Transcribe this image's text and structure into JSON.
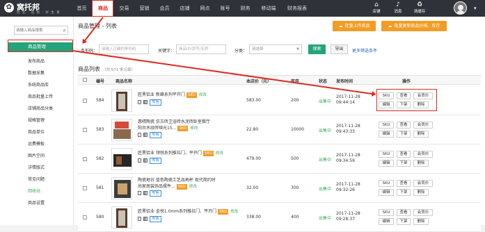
{
  "brand": {
    "name": "窝托邦",
    "slogan": "创 业 · 连 锁 · 好 生 意"
  },
  "nav": [
    {
      "label": "首页"
    },
    {
      "label": "商品"
    },
    {
      "label": "交易"
    },
    {
      "label": "营销"
    },
    {
      "label": "会员"
    },
    {
      "label": "店铺"
    },
    {
      "label": "网点"
    },
    {
      "label": "账号"
    },
    {
      "label": "财务"
    },
    {
      "label": "移动端"
    },
    {
      "label": "财务报表"
    }
  ],
  "top_icons": {
    "store": {
      "label": "店铺",
      "icon": "home-icon"
    },
    "message": {
      "label": "消息",
      "icon": "bell-icon"
    },
    "clear_cache": {
      "label": "清缓存",
      "icon": "trash-icon"
    }
  },
  "sidebar": {
    "search_placeholder": "请输入商品搜索",
    "active": "商品管理",
    "items": [
      "发布商品",
      "数据采集",
      "系统商品库",
      "商品批量上传",
      "店铺商品分类",
      "规格管理",
      "商品单位",
      "运费模板",
      "图片空间",
      "详情版式",
      "常见问题",
      "回收站",
      "商品设置"
    ]
  },
  "page": {
    "breadcrumb": "商品管理 - 列表",
    "upload_btn": "批量上传商品",
    "update_btn": "批量更新商品价格、库存",
    "filters": {
      "barcode_label": "条形码：",
      "barcode_placeholder": "请输入正确的条形码",
      "keyword_label": "关键字：",
      "keyword_placeholder": "商品ID/货号/名称",
      "category_label": "分类：",
      "category_value": "请选择",
      "search": "搜索",
      "export": "导出",
      "more": "更多筛选条件"
    },
    "list_title": "商品列表",
    "list_count": "（共 571 条记录）",
    "columns": {
      "id": "编号",
      "name": "商品名称",
      "price": "本店价（元）",
      "stock": "库存",
      "status": "状态",
      "time": "发布时间",
      "ops": "操作"
    },
    "op_labels": {
      "sku": "SKU",
      "view": "查看",
      "member_price": "会员价",
      "edit": "编辑",
      "off_shelf": "下架",
      "delete": "删除"
    },
    "rows": [
      {
        "id": "584",
        "name1": "匠黑铝业 新峰系列平开门",
        "name2": "",
        "tag": "零售",
        "price": "583.00",
        "stock": "200",
        "status": "出售中",
        "date": "2017-11-28",
        "time": "09:44:14"
      },
      {
        "id": "583",
        "name1": "惠晴陶瓷 仿古砖卫浴砖水泥砖卧室餐厅",
        "name2": "阳台木纹砖哑光15...",
        "tag": "零售",
        "price": "22.80",
        "stock": "10000",
        "status": "出售中",
        "date": "2017-11-28",
        "time": "09:43:33"
      },
      {
        "id": "582",
        "name1": "匠黑铝业 领悦系列推拉门、平开门",
        "name2": "",
        "tag": "零售",
        "price": "479.00",
        "stock": "500",
        "status": "出售中",
        "date": "2017-11-28",
        "time": "09:34:59"
      },
      {
        "id": "581",
        "name1": "陶瓷地台 蓝色陶瓷工艺品地杯 现代简约时",
        "name2": "尚家居装饰品摆件...",
        "tag": "零售",
        "price": "32.00",
        "stock": "300",
        "status": "出售中",
        "date": "2017-11-28",
        "time": "09:32:26"
      },
      {
        "id": "580",
        "name1": "匠黑铝业 金悦1.0mm系列推拉门、平开门",
        "name2": "",
        "tag": "零售",
        "price": "338.00",
        "stock": "400",
        "status": "出售中",
        "date": "2017-11-28",
        "time": "09:28:37"
      }
    ]
  }
}
